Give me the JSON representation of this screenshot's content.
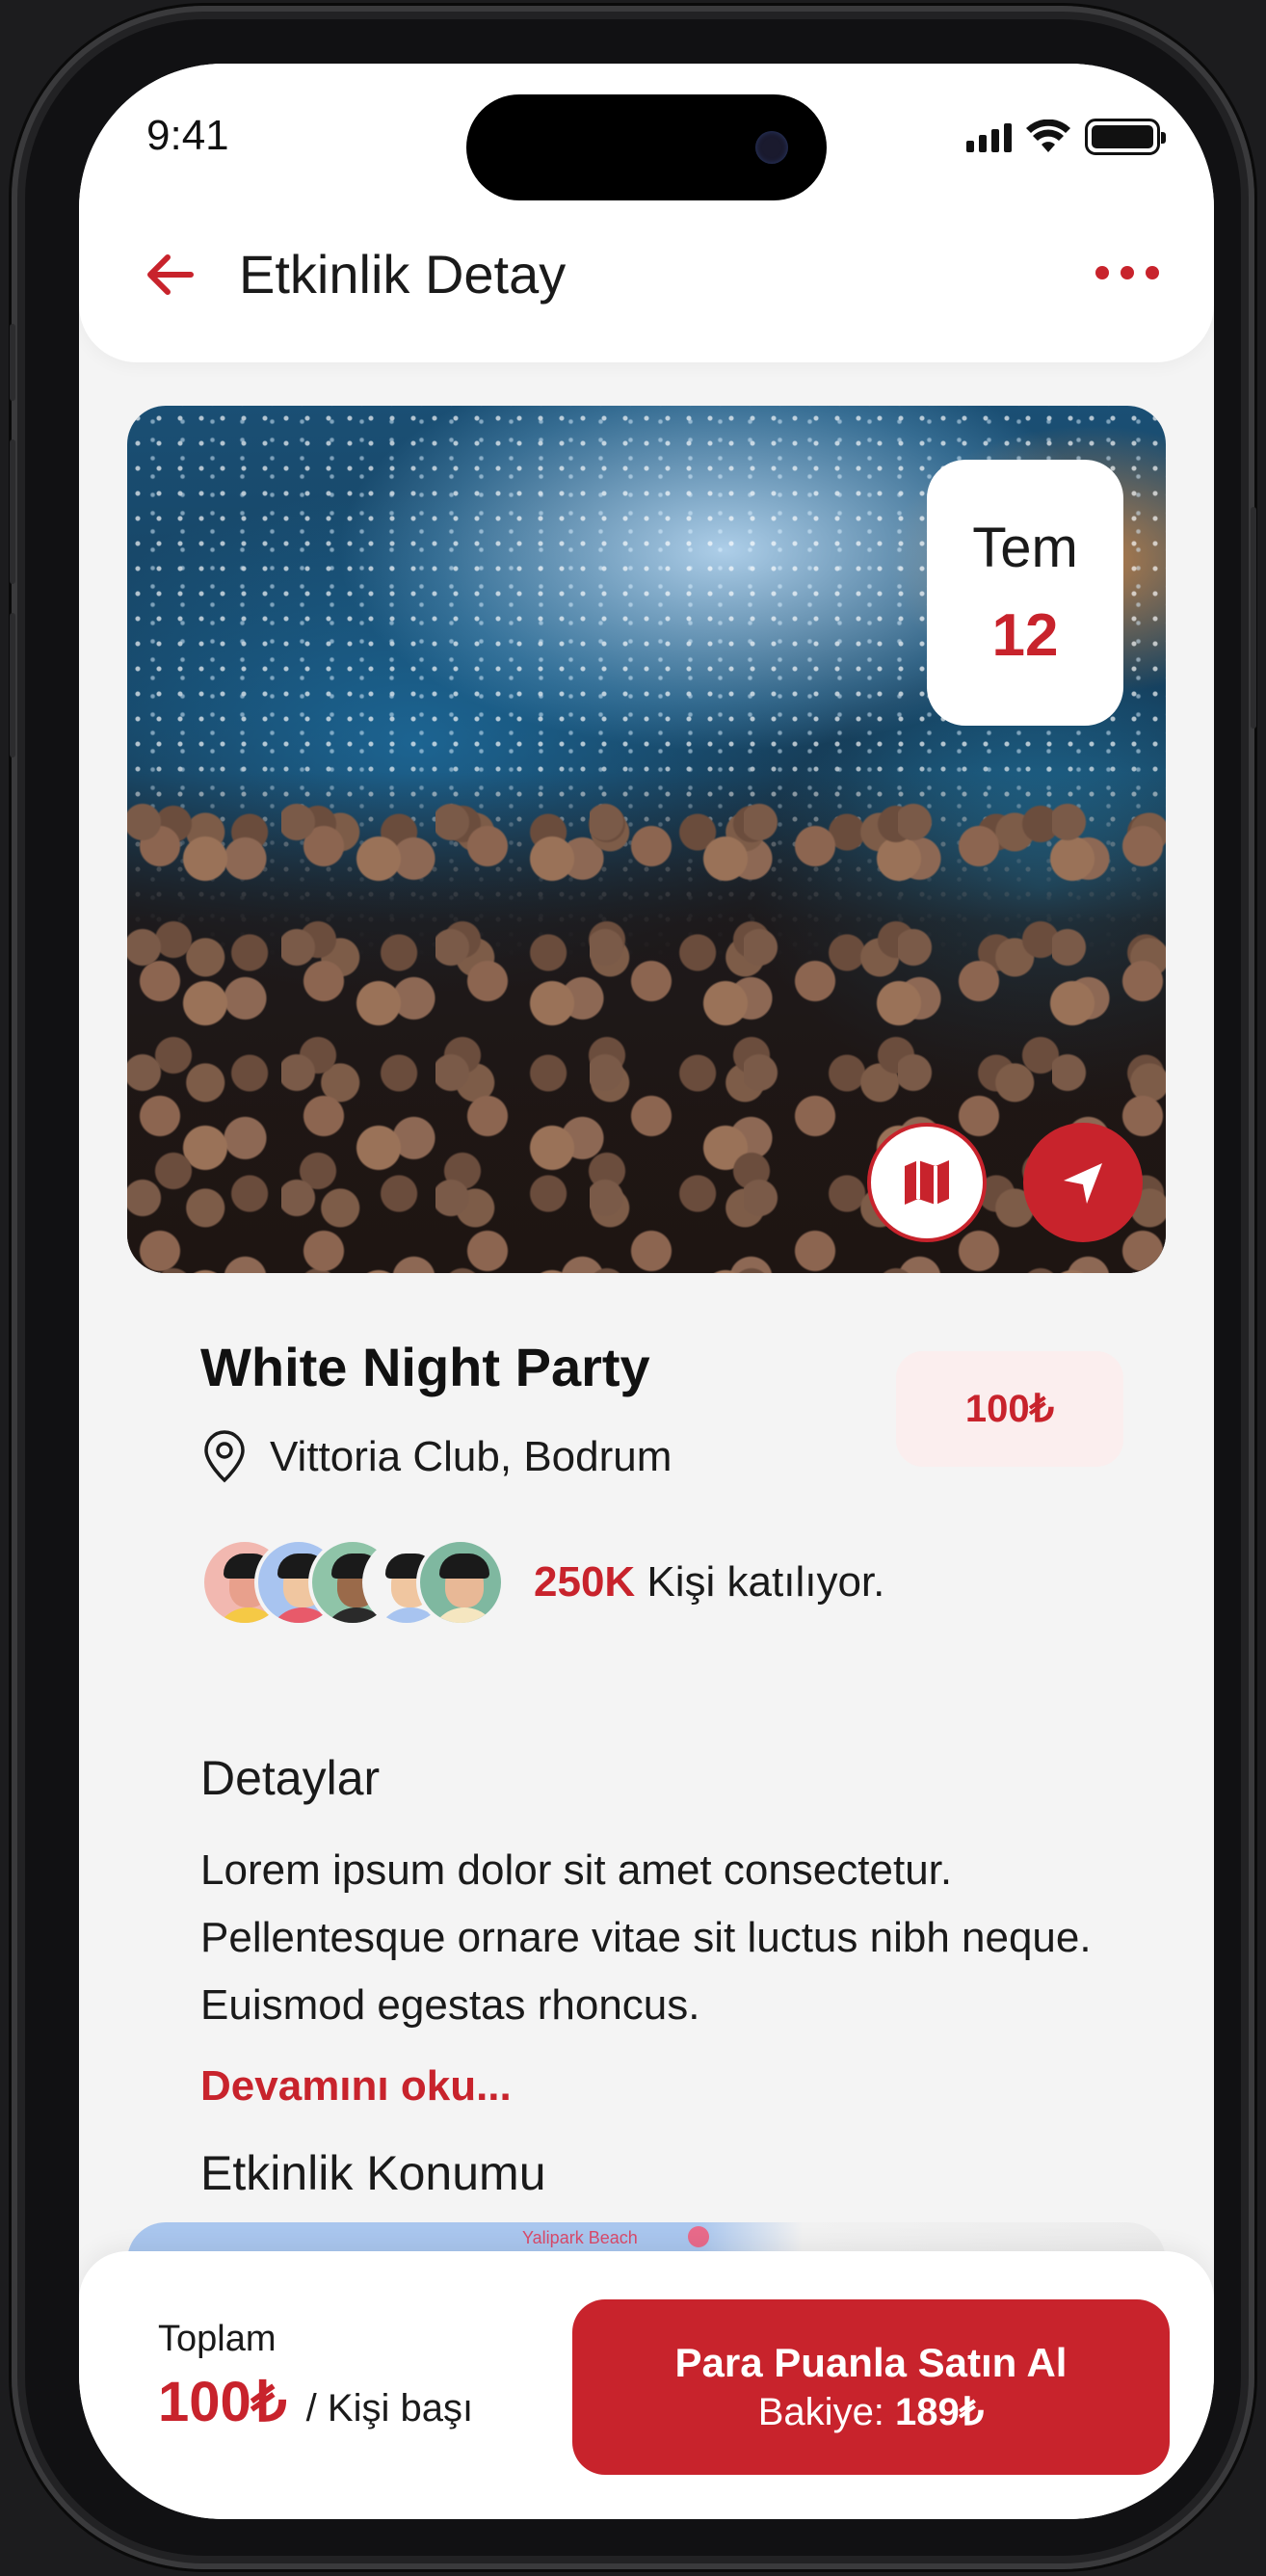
{
  "status_bar": {
    "time": "9:41"
  },
  "header": {
    "title": "Etkinlik Detay"
  },
  "event": {
    "date_month": "Tem",
    "date_day": "12",
    "title": "White Night Party",
    "price": "100₺",
    "location": "Vittoria Club, Bodrum",
    "attendees_count": "250K",
    "attendees_text": "Kişi katılıyor.",
    "avatars": [
      {
        "bg": "#f2b8b0",
        "face": "#e8a08c",
        "body": "#f5c945"
      },
      {
        "bg": "#a8c4f0",
        "face": "#f0c6a0",
        "body": "#e85a6a"
      },
      {
        "bg": "#8fc4a8",
        "face": "#9a6a4a",
        "body": "#2a2a2a"
      },
      {
        "bg": "#f4f4f4",
        "face": "#f0c6a0",
        "body": "#a8c4f0"
      },
      {
        "bg": "#7fb8a0",
        "face": "#e8b896",
        "body": "#f5e6c0"
      }
    ]
  },
  "details": {
    "heading": "Detaylar",
    "description": "Lorem ipsum dolor sit amet consectetur. Pellentesque ornare vitae sit luctus nibh neque. Euismod egestas rhoncus.",
    "read_more": "Devamını oku..."
  },
  "location_section": {
    "heading": "Etkinlik Konumu",
    "map_label": "Yalipark Beach"
  },
  "footer": {
    "total_label": "Toplam",
    "total_amount": "100₺",
    "total_unit": "/ Kişi başı",
    "buy_label": "Para Puanla Satın Al",
    "balance_label": "Bakiye:",
    "balance_value": "189₺"
  },
  "colors": {
    "accent": "#c8232c",
    "background": "#f4f4f4",
    "price_badge_bg": "#fbeeee"
  }
}
